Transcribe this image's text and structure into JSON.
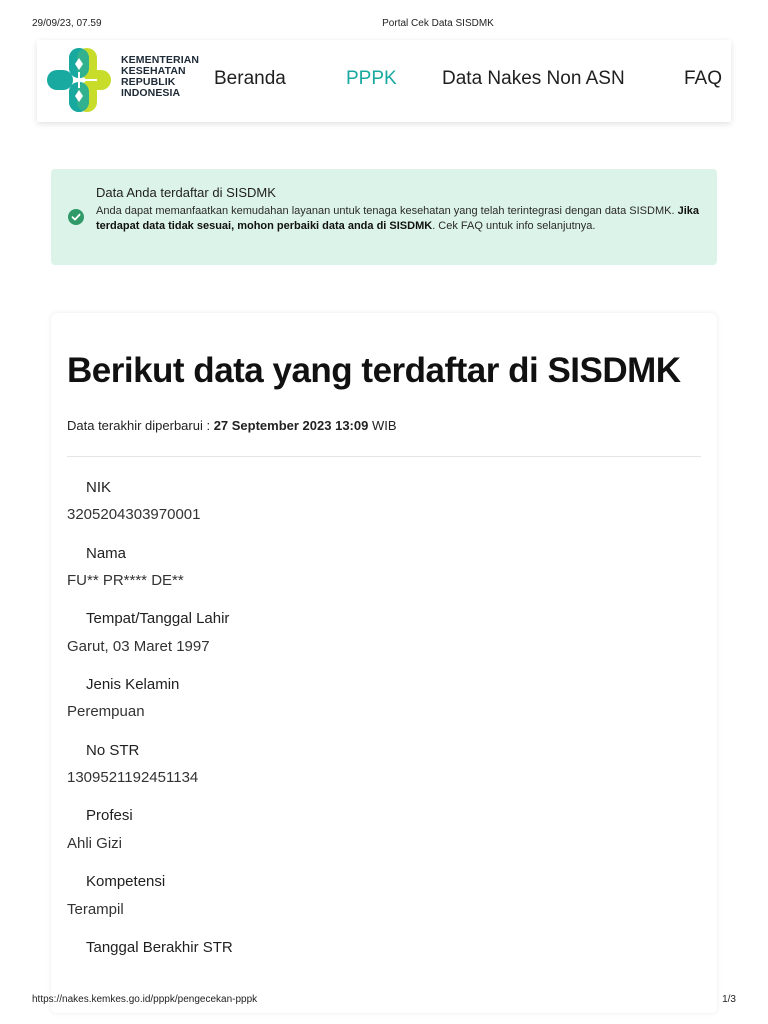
{
  "print_header": {
    "date": "29/09/23, 07.59",
    "title": "Portal Cek Data SISDMK"
  },
  "logo": {
    "lines": [
      "KEMENTERIAN",
      "KESEHATAN",
      "REPUBLIK",
      "INDONESIA"
    ]
  },
  "nav": {
    "items": [
      {
        "label": "Beranda",
        "active": false
      },
      {
        "label": "PPPK",
        "active": true
      },
      {
        "label": "Data Nakes Non ASN",
        "active": false
      },
      {
        "label": "FAQ",
        "active": false
      }
    ]
  },
  "alert": {
    "title": "Data Anda terdaftar di SISDMK",
    "body_part1": "Anda dapat memanfaatkan kemudahan layanan untuk tenaga kesehatan yang telah terintegrasi dengan data SISDMK. ",
    "body_bold": "Jika terdapat data tidak sesuai, mohon perbaiki data anda di SISDMK",
    "body_part2": ". Cek FAQ untuk info selanjutnya."
  },
  "card": {
    "title": "Berikut data yang terdaftar di SISDMK",
    "updated_prefix": "Data terakhir diperbarui : ",
    "updated_value": "27 September 2023 13:09",
    "updated_suffix": " WIB",
    "fields": [
      {
        "label": "NIK",
        "value": "3205204303970001"
      },
      {
        "label": "Nama",
        "value": "FU** PR**** DE**"
      },
      {
        "label": "Tempat/Tanggal Lahir",
        "value": "Garut, 03 Maret 1997"
      },
      {
        "label": "Jenis Kelamin",
        "value": "Perempuan"
      },
      {
        "label": "No STR",
        "value": "1309521192451134"
      },
      {
        "label": "Profesi",
        "value": "Ahli Gizi"
      },
      {
        "label": "Kompetensi",
        "value": "Terampil"
      },
      {
        "label": "Tanggal Berakhir STR",
        "value": ""
      }
    ]
  },
  "print_footer": {
    "url": "https://nakes.kemkes.go.id/pppk/pengecekan-pppk",
    "page": "1/3"
  },
  "colors": {
    "accent": "#18a9a0",
    "alert_bg": "#dcf3e9",
    "success_icon": "#2f9a68",
    "logo_lime": "#c8dc2a"
  }
}
